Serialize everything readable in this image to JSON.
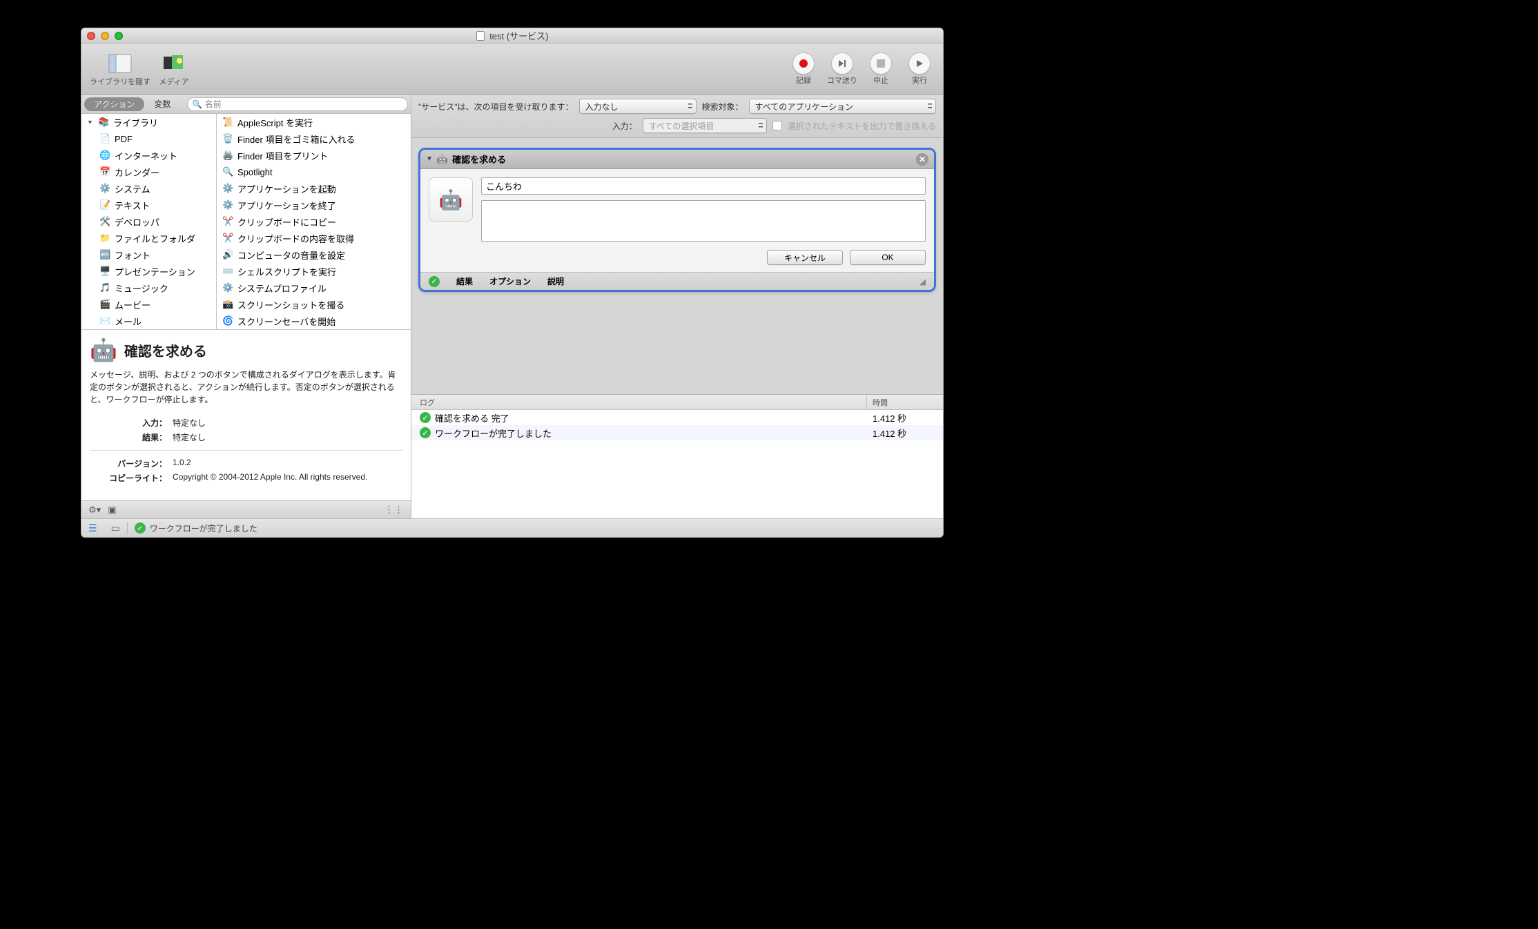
{
  "window": {
    "title": "test (サービス)"
  },
  "toolbar": {
    "hide_library_label": "ライブラリを隠す",
    "media_label": "メディア",
    "record_label": "記録",
    "step_label": "コマ送り",
    "stop_label": "中止",
    "run_label": "実行"
  },
  "library": {
    "tabs": {
      "actions": "アクション",
      "variables": "変数"
    },
    "search_placeholder": "名前",
    "root": "ライブラリ",
    "categories": [
      "PDF",
      "インターネット",
      "カレンダー",
      "システム",
      "テキスト",
      "デベロッパ",
      "ファイルとフォルダ",
      "フォント",
      "プレゼンテーション",
      "ミュージック",
      "ムービー",
      "メール"
    ],
    "actions": [
      "AppleScript を実行",
      "Finder 項目をゴミ箱に入れる",
      "Finder 項目をプリント",
      "Spotlight",
      "アプリケーションを起動",
      "アプリケーションを終了",
      "クリップボードにコピー",
      "クリップボードの内容を取得",
      "コンピュータの音量を設定",
      "シェルスクリプトを実行",
      "システムプロファイル",
      "スクリーンショットを撮る",
      "スクリーンセーバを開始"
    ]
  },
  "description": {
    "title": "確認を求める",
    "body": "メッセージ、説明、および 2 つのボタンで構成されるダイアログを表示します。肯定のボタンが選択されると、アクションが続行します。否定のボタンが選択されると、ワークフローが停止します。",
    "meta": {
      "input_k": "入力：",
      "input_v": "特定なし",
      "result_k": "結果：",
      "result_v": "特定なし",
      "version_k": "バージョン：",
      "version_v": "1.0.2",
      "copyright_k": "コピーライト：",
      "copyright_v": "Copyright © 2004-2012 Apple Inc.  All rights reserved."
    }
  },
  "service": {
    "receives_label": "\"サービス\"は、次の項目を受け取ります：",
    "receives_value": "入力なし",
    "search_label": "検索対象：",
    "search_value": "すべてのアプリケーション",
    "input_label": "入力：",
    "input_value": "すべての選択項目",
    "replace_label": "選択されたテキストを出力で置き換える"
  },
  "action_card": {
    "title": "確認を求める",
    "message_value": "こんちわ",
    "description_value": "",
    "cancel_label": "キャンセル",
    "ok_label": "OK",
    "tabs": {
      "results": "結果",
      "options": "オプション",
      "description": "説明"
    }
  },
  "log": {
    "head_msg": "ログ",
    "head_time": "時間",
    "rows": [
      {
        "msg": "確認を求める 完了",
        "time": "1.412 秒"
      },
      {
        "msg": "ワークフローが完了しました",
        "time": "1.412 秒"
      }
    ]
  },
  "status": {
    "text": "ワークフローが完了しました"
  },
  "icons": {
    "cat": [
      "📄",
      "🌐",
      "📅",
      "⚙️",
      "📝",
      "🛠️",
      "📁",
      "🔤",
      "🖥️",
      "🎵",
      "🎬",
      "✉️"
    ],
    "act": [
      "📜",
      "🗑️",
      "🖨️",
      "🔍",
      "⚙️",
      "⚙️",
      "✂️",
      "✂️",
      "🔊",
      "⌨️",
      "⚙️",
      "📸",
      "🌀"
    ]
  }
}
